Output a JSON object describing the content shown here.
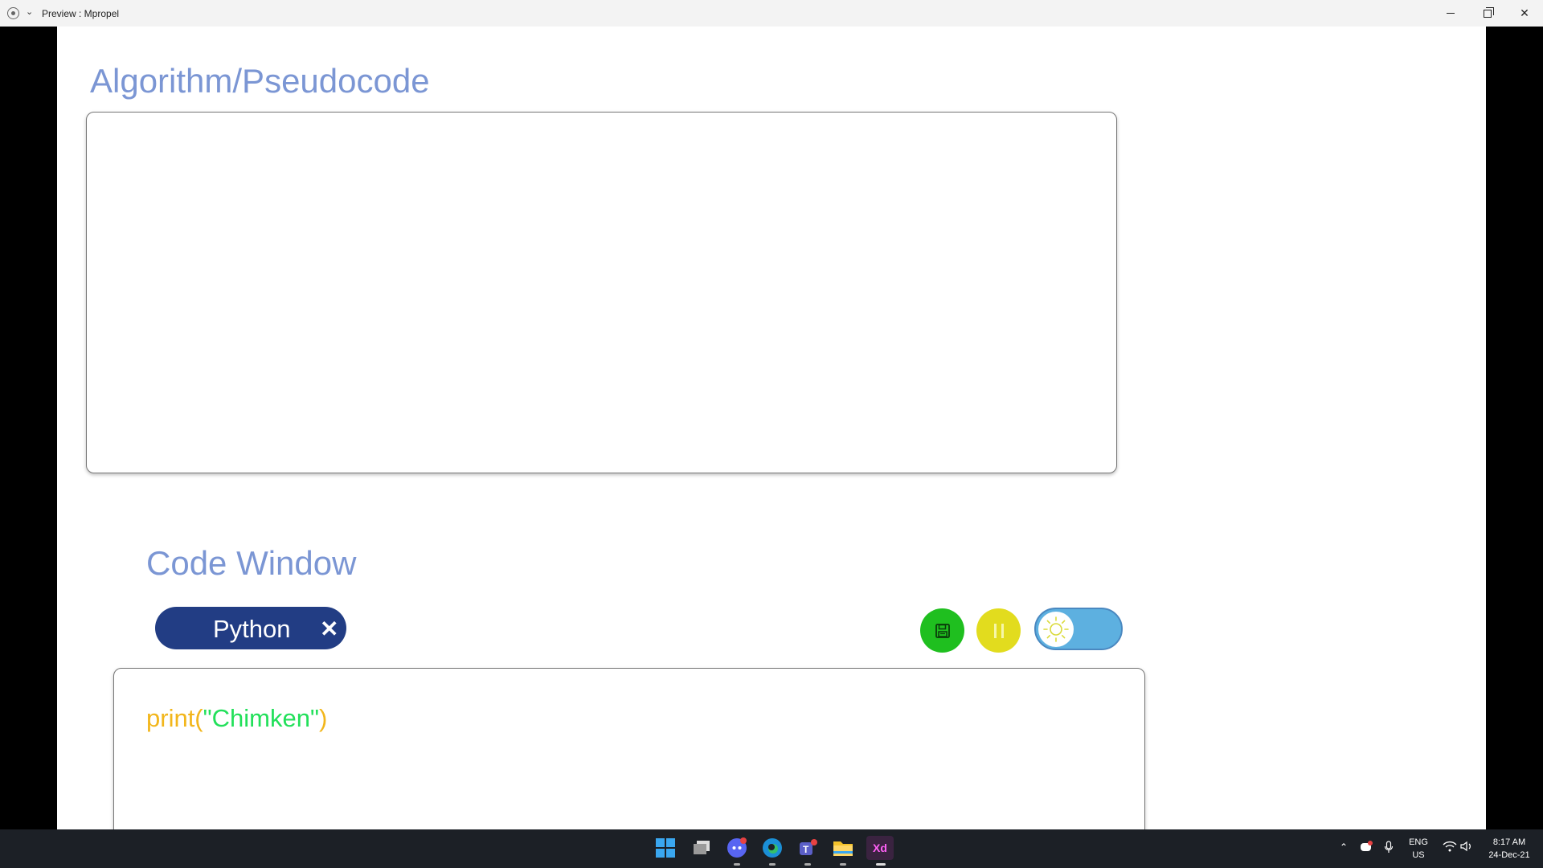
{
  "window": {
    "title": "Preview : Mpropel"
  },
  "algorithm": {
    "title": "Algorithm/Pseudocode",
    "content": ""
  },
  "code_window": {
    "title": "Code Window",
    "language": "Python",
    "code_fn": "print(",
    "code_str": "\"Chimken\"",
    "code_close": ")"
  },
  "controls": {
    "save_icon": "floppy-disk-icon",
    "pause_icon": "pause-icon",
    "theme_icon": "sun-icon"
  },
  "colors": {
    "heading": "#7b96d4",
    "language_pill": "#223d84",
    "save_button": "#1fbf1f",
    "pause_button": "#e2dc1e",
    "theme_toggle": "#5db0e0",
    "code_function": "#f2b61b",
    "code_string": "#22e05a"
  },
  "taskbar": {
    "apps": [
      "windows-start",
      "task-view",
      "discord",
      "edge",
      "teams",
      "file-explorer",
      "adobe-xd"
    ],
    "xd_label": "Xd",
    "language_line1": "ENG",
    "language_line2": "US",
    "time": "8:17 AM",
    "date": "24-Dec-21"
  }
}
